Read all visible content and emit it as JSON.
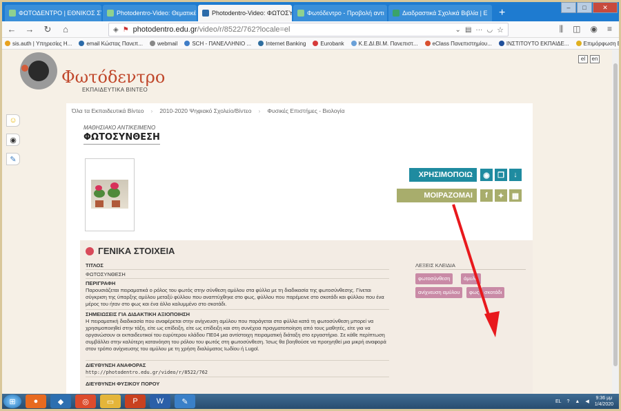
{
  "browser": {
    "tabs": [
      {
        "label": "ΦΩΤΟΔΕΝΤΡΟ | ΕΘΝΙΚΟΣ ΣΥΣ",
        "active": false
      },
      {
        "label": "Photodentro-Video: Θεματικέ",
        "active": false
      },
      {
        "label": "Photodentro-Video: ΦΩΤΟΣΥΝ",
        "active": true
      },
      {
        "label": "Φωτόδεντρο - Προβολή αντι",
        "active": false
      },
      {
        "label": "Διαδραστικά Σχολικά Βιβλία | Ε",
        "active": false
      }
    ],
    "new_tab": "+",
    "url_host": "photodentro.edu.gr",
    "url_path": "/video/r/8522/762?locale=el",
    "bookmarks": [
      "sis.auth | Υπηρεσίες Η...",
      "email Κώστας Πανεπ...",
      "webmail",
      "SCH - ΠΑΝΕΛΛΗΝΙΟ ...",
      "Internet Banking",
      "Eurobank",
      "Κ.Ε.ΔΙ.ΒΙ.Μ. Πανεπιστ...",
      "eClass Πανεπιστημίου...",
      "ΙΝΣΤΙΤΟΥΤΟ ΕΚΠΑΙΔΕ...",
      "Επιμόρφωση Β2 Επιπ..."
    ]
  },
  "site": {
    "logo_title": "Φωτόδεντρο",
    "logo_subtitle": "ΕΚΠΑΙΔΕΥΤΙΚΑ ΒΙΝΤΕΟ",
    "lang_el": "el",
    "lang_en": "en"
  },
  "breadcrumb": [
    "Όλα τα Εκπαιδευτικά Βίντεο",
    "2010-2020 Ψηφιακό Σχολείο/Βίντεο",
    "Φυσικές Επιστήμες - Βιολογία"
  ],
  "object": {
    "type_label": "ΜΑΘΗΣΙΑΚΟ ΑΝΤΙΚΕΙΜΕΝΟ",
    "title": "ΦΩΤΟΣΥΝΘΕΣΗ"
  },
  "actions": {
    "use_label": "ΧΡΗΣΙΜΟΠΟΙΩ",
    "share_label": "ΜΟΙΡΑΖΟΜΑΙ"
  },
  "general": {
    "heading": "ΓΕΝΙΚΑ ΣΤΟΙΧΕΙΑ",
    "title_label": "ΤΙΤΛΟΣ",
    "title_value": "ΦΩΤΟΣΥΝΘΕΣΗ",
    "desc_label": "ΠΕΡΙΓΡΑΦΗ",
    "desc_value": "Παρουσιάζεται πειραματικά ο ρόλος του φωτός στην σύνθεση αμύλου στα φύλλα με τη διαδικασία της φωτοσύνθεσης. Γίνεται σύγκριση της ύπαρξης αμύλου μεταξύ φύλλου που αναπτύχθηκε στο φως, φύλλου που παρέμεινε στο σκοτάδι και φύλλου που ένα μέρος του ήταν στο φως και ένα άλλο καλυμμένο στο σκοτάδι.",
    "notes_label": "ΣΗΜΕΙΩΣΕΙΣ ΓΙΑ ΔΙΔΑΚΤΙΚΗ ΑΞΙΟΠΟΙΗΣΗ",
    "notes_value": "Η πειραματική διαδικασία που αναφέρεται στην ανίχνευση αμύλου που παράγεται στα φύλλα κατά τη φωτοσύνθεση μπορεί να χρησιμοποιηθεί στην τάξη, είτε ως επίδειξη, είτε ως επίδειξη και στη συνέχεια πραγματοποίηση από τους μαθητές, είτε για να οργανώσουν οι εκπαιδευτικοί του ευρύτερου κλάδου ΠΕ04 μια αντίστοιχη πειραματική διάταξη στο εργαστήριο. Σε κάθε περίπτωση συμβάλλει στην καλύτερη κατανόηση του ρόλου του φωτός στη φωτοσύνθεση. Ίσως θα βοηθούσε να προηγηθεί μια μικρή αναφορά στον τρόπο ανίχνευσης του αμύλου με τη χρήση διαλύματος Ιωδίου ή Lugol.",
    "ref_label": "ΔΙΕΥΘΥΝΣΗ ΑΝΑΦΟΡΑΣ",
    "ref_value": "http://photodentro.edu.gr/video/r/8522/762",
    "phys_label": "ΔΙΕΥΘΥΝΣΗ ΦΥΣΙΚΟΥ ΠΟΡΟΥ",
    "keywords_label": "ΛΕΞΕΙΣ ΚΛΕΙΔΙΑ",
    "keywords": [
      "φωτοσύνθεση",
      "άμυλο",
      "ανίχνευση αμύλου",
      "φως",
      "σκοτάδι"
    ]
  },
  "taskbar": {
    "lang": "EL",
    "time": "9:36 μμ",
    "date": "1/4/2020"
  },
  "colors": {
    "accent_teal": "#1f8ba0",
    "accent_olive": "#a8ad6c",
    "tag_pink": "#c98aa6",
    "logo_red": "#c0472b",
    "annotation_arrow": "#e8191d"
  }
}
